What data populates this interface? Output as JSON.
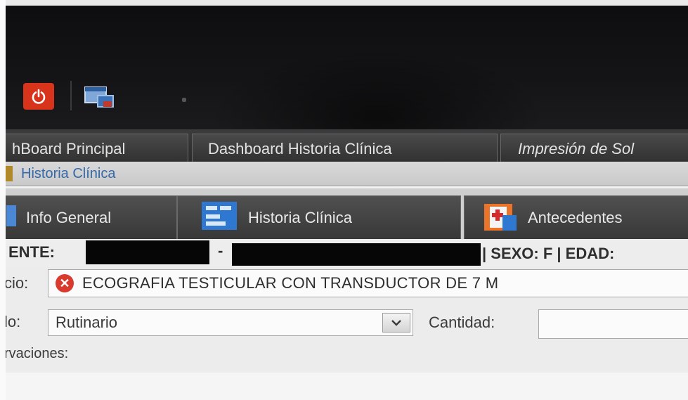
{
  "main_tabs": [
    {
      "label": "hBoard Principal"
    },
    {
      "label": "Dashboard Historia Clínica"
    },
    {
      "label": "Impresión de Sol"
    }
  ],
  "sub_tab": {
    "label": "Historia Clínica"
  },
  "inner_tabs": [
    {
      "label": "Info General"
    },
    {
      "label": "Historia Clínica"
    },
    {
      "label": "Antecedentes"
    }
  ],
  "patient": {
    "label": "ENTE:",
    "separator": "-",
    "sex_age": "| SEXO: F | EDAD:"
  },
  "form": {
    "service_label": "cio:",
    "service_value": "ECOGRAFIA TESTICULAR CON TRANSDUCTOR DE 7 M",
    "type_label": "lo:",
    "type_value": "Rutinario",
    "quantity_label": "Cantidad:",
    "quantity_value": "",
    "observations_label": "rvaciones:"
  },
  "colors": {
    "power_button": "#d8341c",
    "error_icon": "#d93a2e",
    "subtab_text": "#3568a8"
  },
  "icons": [
    "power-icon",
    "app-window-icon",
    "document-icon",
    "notes-icon",
    "medical-kit-icon",
    "error-icon",
    "chevron-down-icon"
  ]
}
